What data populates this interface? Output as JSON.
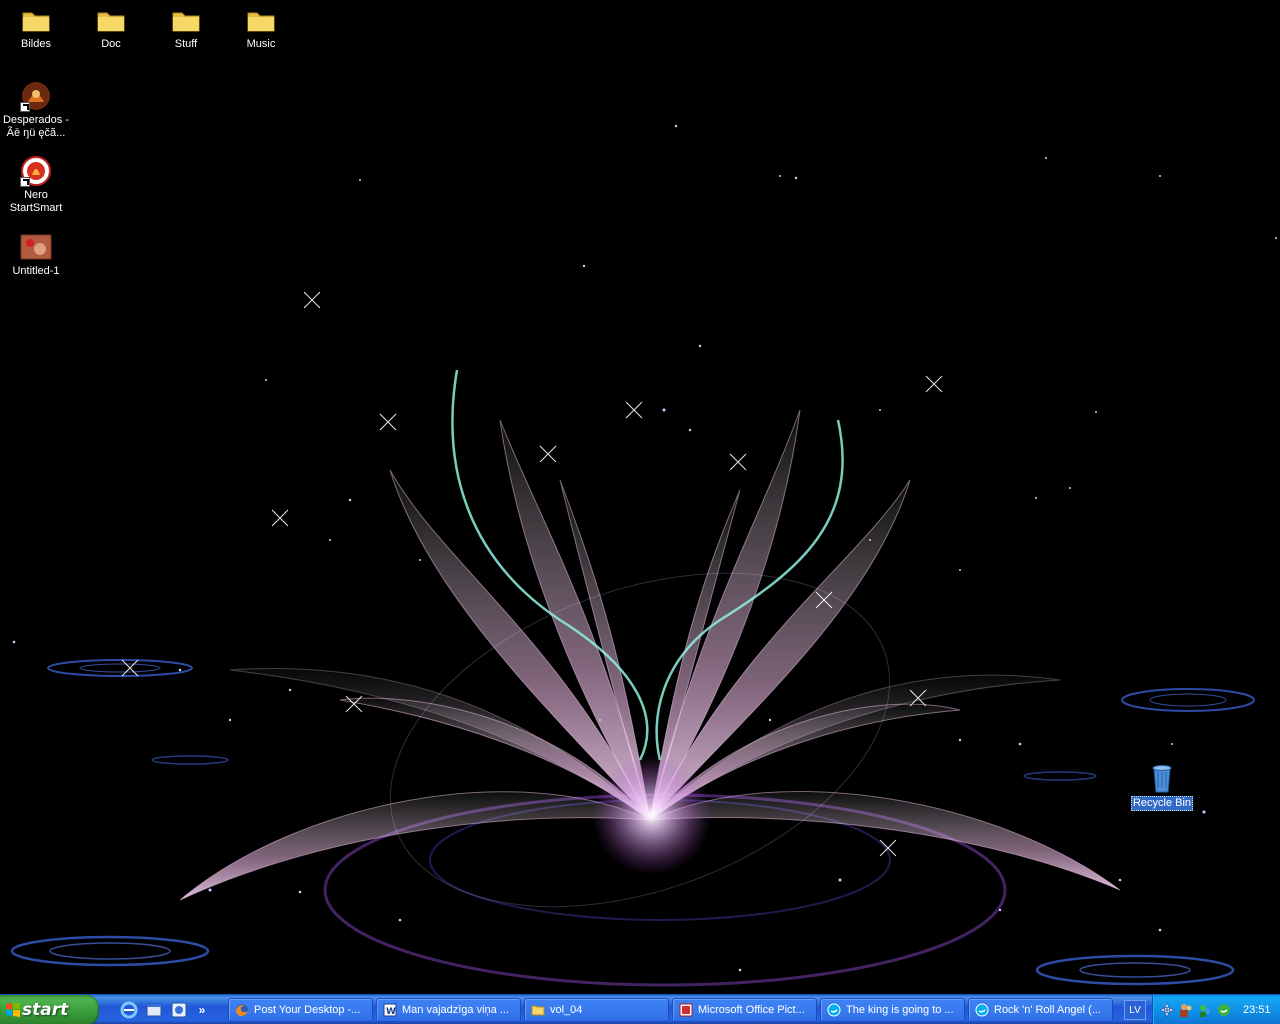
{
  "desktop": {
    "icons": [
      {
        "label": "Bildes",
        "icon": "folder-icon"
      },
      {
        "label": "Doc",
        "icon": "folder-icon"
      },
      {
        "label": "Stuff",
        "icon": "folder-icon"
      },
      {
        "label": "Music",
        "icon": "folder-icon"
      },
      {
        "label_line1": "Desperados -",
        "label_line2": "Ãē ŋü ęčã...",
        "icon": "desperados-game-icon"
      },
      {
        "label_line1": "Nero",
        "label_line2": "StartSmart",
        "icon": "nero-icon"
      },
      {
        "label": "Untitled-1",
        "icon": "image-file-icon"
      },
      {
        "label": "Recycle Bin",
        "icon": "recycle-bin-icon"
      }
    ]
  },
  "taskbar": {
    "start_label": "start",
    "quick_launch": [
      {
        "icon": "internet-explorer-icon"
      },
      {
        "icon": "explorer-icon"
      },
      {
        "icon": "media-icon"
      }
    ],
    "quick_launch_more": "»",
    "tasks": [
      {
        "label": "Post Your Desktop -...",
        "icon": "firefox-icon",
        "active": false
      },
      {
        "label": "Man vajadzīga viņa ...",
        "icon": "word-icon",
        "active": false
      },
      {
        "label": "vol_04",
        "icon": "folder-icon",
        "active": false
      },
      {
        "label": "Microsoft Office Pict...",
        "icon": "picture-manager-icon",
        "active": false
      },
      {
        "label": "The king is going to ...",
        "icon": "skype-icon",
        "active": false
      },
      {
        "label": "Rock 'n' Roll Angel (...",
        "icon": "skype-icon",
        "active": false
      }
    ],
    "language": "LV",
    "tray_icons": [
      "network-icon",
      "people-icon",
      "messenger-icon",
      "skype-icon"
    ],
    "clock": "23:51"
  },
  "colors": {
    "taskbar_blue": "#2157d7",
    "start_green": "#379b37",
    "tray_blue": "#0f8be3",
    "wallpaper_flower": "#e6b7e6",
    "wallpaper_teal": "#8ff0e0"
  }
}
